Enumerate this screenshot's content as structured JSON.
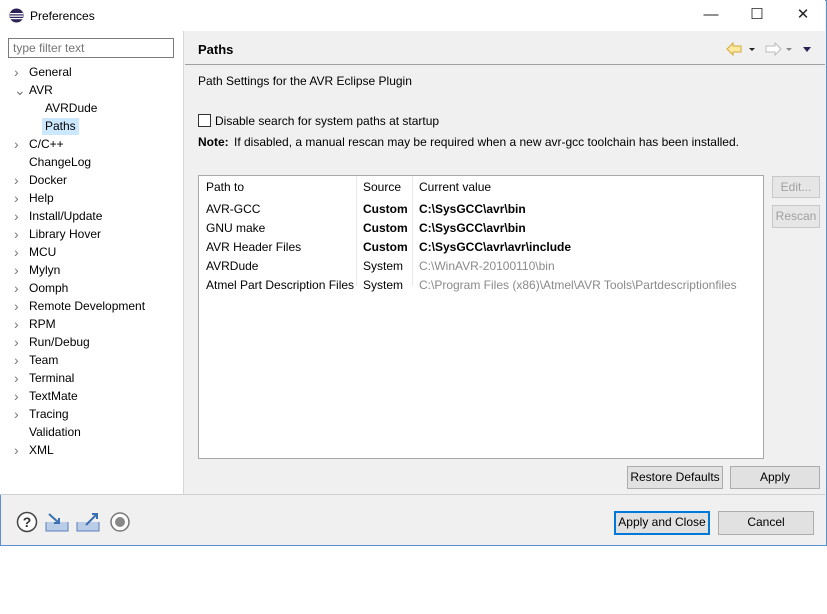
{
  "window": {
    "title": "Preferences",
    "minimize": "—",
    "maximize": "☐",
    "close": "✕"
  },
  "filter": {
    "placeholder": "type filter text"
  },
  "tree": [
    {
      "label": "General",
      "chevron": ">"
    },
    {
      "label": "AVR",
      "chevron": "v"
    },
    {
      "label": "AVRDude",
      "child": true
    },
    {
      "label": "Paths",
      "child": true,
      "selected": true
    },
    {
      "label": "C/C++",
      "chevron": ">"
    },
    {
      "label": "ChangeLog"
    },
    {
      "label": "Docker",
      "chevron": ">"
    },
    {
      "label": "Help",
      "chevron": ">"
    },
    {
      "label": "Install/Update",
      "chevron": ">"
    },
    {
      "label": "Library Hover",
      "chevron": ">"
    },
    {
      "label": "MCU",
      "chevron": ">"
    },
    {
      "label": "Mylyn",
      "chevron": ">"
    },
    {
      "label": "Oomph",
      "chevron": ">"
    },
    {
      "label": "Remote Development",
      "chevron": ">"
    },
    {
      "label": "RPM",
      "chevron": ">"
    },
    {
      "label": "Run/Debug",
      "chevron": ">"
    },
    {
      "label": "Team",
      "chevron": ">"
    },
    {
      "label": "Terminal",
      "chevron": ">"
    },
    {
      "label": "TextMate",
      "chevron": ">"
    },
    {
      "label": "Tracing",
      "chevron": ">"
    },
    {
      "label": "Validation"
    },
    {
      "label": "XML",
      "chevron": ">"
    }
  ],
  "page": {
    "title": "Paths",
    "description": "Path Settings for the AVR Eclipse Plugin",
    "checkbox_label": "Disable search for system paths at startup",
    "note_label": "Note:",
    "note_text": "If disabled, a manual rescan may be required when a new avr-gcc toolchain has been installed.",
    "columns": [
      "Path to",
      "Source",
      "Current value"
    ],
    "rows": [
      {
        "path": "AVR-GCC",
        "source": "Custom",
        "value": "C:\\SysGCC\\avr\\bin",
        "custom": true
      },
      {
        "path": "GNU make",
        "source": "Custom",
        "value": "C:\\SysGCC\\avr\\bin",
        "custom": true
      },
      {
        "path": "AVR Header Files",
        "source": "Custom",
        "value": "C:\\SysGCC\\avr\\avr\\include",
        "custom": true
      },
      {
        "path": "AVRDude",
        "source": "System",
        "value": "C:\\WinAVR-20100110\\bin",
        "custom": false
      },
      {
        "path": "Atmel Part Description Files",
        "source": "System",
        "value": "C:\\Program Files (x86)\\Atmel\\AVR Tools\\Partdescriptionfiles",
        "custom": false
      }
    ],
    "edit": "Edit...",
    "rescan": "Rescan",
    "restore": "Restore Defaults",
    "apply": "Apply"
  },
  "footer": {
    "apply_close": "Apply and Close",
    "cancel": "Cancel"
  }
}
